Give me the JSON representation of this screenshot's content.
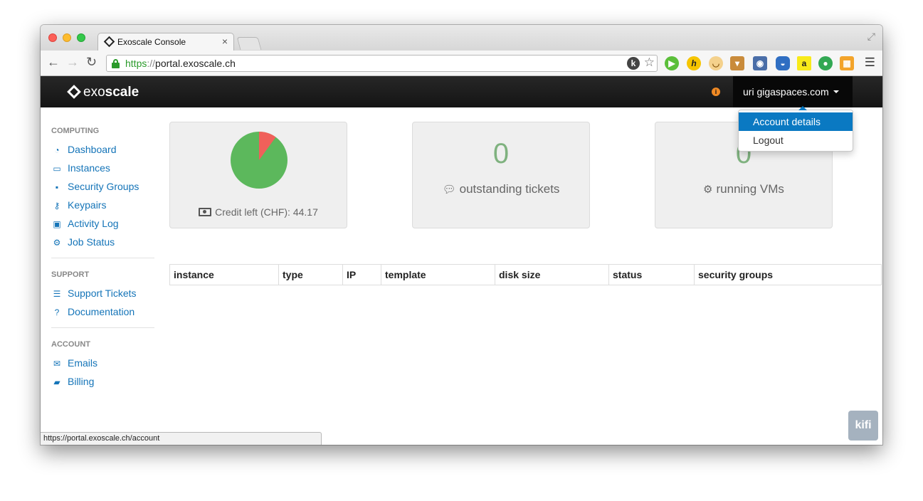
{
  "browser": {
    "tab_title": "Exoscale Console",
    "tab_close": "×",
    "url_scheme": "https",
    "url_sep": "://",
    "url_host": "portal.exoscale.ch",
    "status_url": "https://portal.exoscale.ch/account",
    "extensions": [
      "k-icon",
      "star-icon",
      "play-icon",
      "h-icon",
      "face-icon",
      "basket-icon",
      "owl-icon",
      "ghost-icon",
      "amazon-icon",
      "evernote-icon",
      "gift-icon"
    ]
  },
  "navbar": {
    "brand_light": "exo",
    "brand_bold": "scale",
    "info_glyph": "i",
    "user": "uri gigaspaces.com"
  },
  "dropdown": {
    "account_details": "Account details",
    "logout": "Logout"
  },
  "sidebar": {
    "computing_header": "COMPUTING",
    "computing": [
      {
        "label": "Dashboard",
        "icon": "dashboard-icon"
      },
      {
        "label": "Instances",
        "icon": "monitor-icon"
      },
      {
        "label": "Security Groups",
        "icon": "lock-icon"
      },
      {
        "label": "Keypairs",
        "icon": "key-icon"
      },
      {
        "label": "Activity Log",
        "icon": "save-icon"
      },
      {
        "label": "Job Status",
        "icon": "cogs-icon"
      }
    ],
    "support_header": "SUPPORT",
    "support": [
      {
        "label": "Support Tickets",
        "icon": "list-icon"
      },
      {
        "label": "Documentation",
        "icon": "question-icon"
      }
    ],
    "account_header": "ACCOUNT",
    "account": [
      {
        "label": "Emails",
        "icon": "envelope-icon"
      },
      {
        "label": "Billing",
        "icon": "book-icon"
      }
    ]
  },
  "cards": {
    "credit_label": "Credit left (CHF): 44.17",
    "credit_used_fraction": 0.1,
    "pie_colors": {
      "remaining": "#5cb85c",
      "used": "#f0605a"
    },
    "tickets_count": "0",
    "tickets_label": "outstanding tickets",
    "vms_count": "0",
    "vms_label": "running VMs"
  },
  "table": {
    "columns": [
      "instance",
      "type",
      "IP",
      "template",
      "disk size",
      "status",
      "security groups"
    ]
  },
  "kifi": "kifi",
  "colors": {
    "accent": "#0a79c2",
    "link": "#1474b8",
    "count": "#7fb27f"
  }
}
